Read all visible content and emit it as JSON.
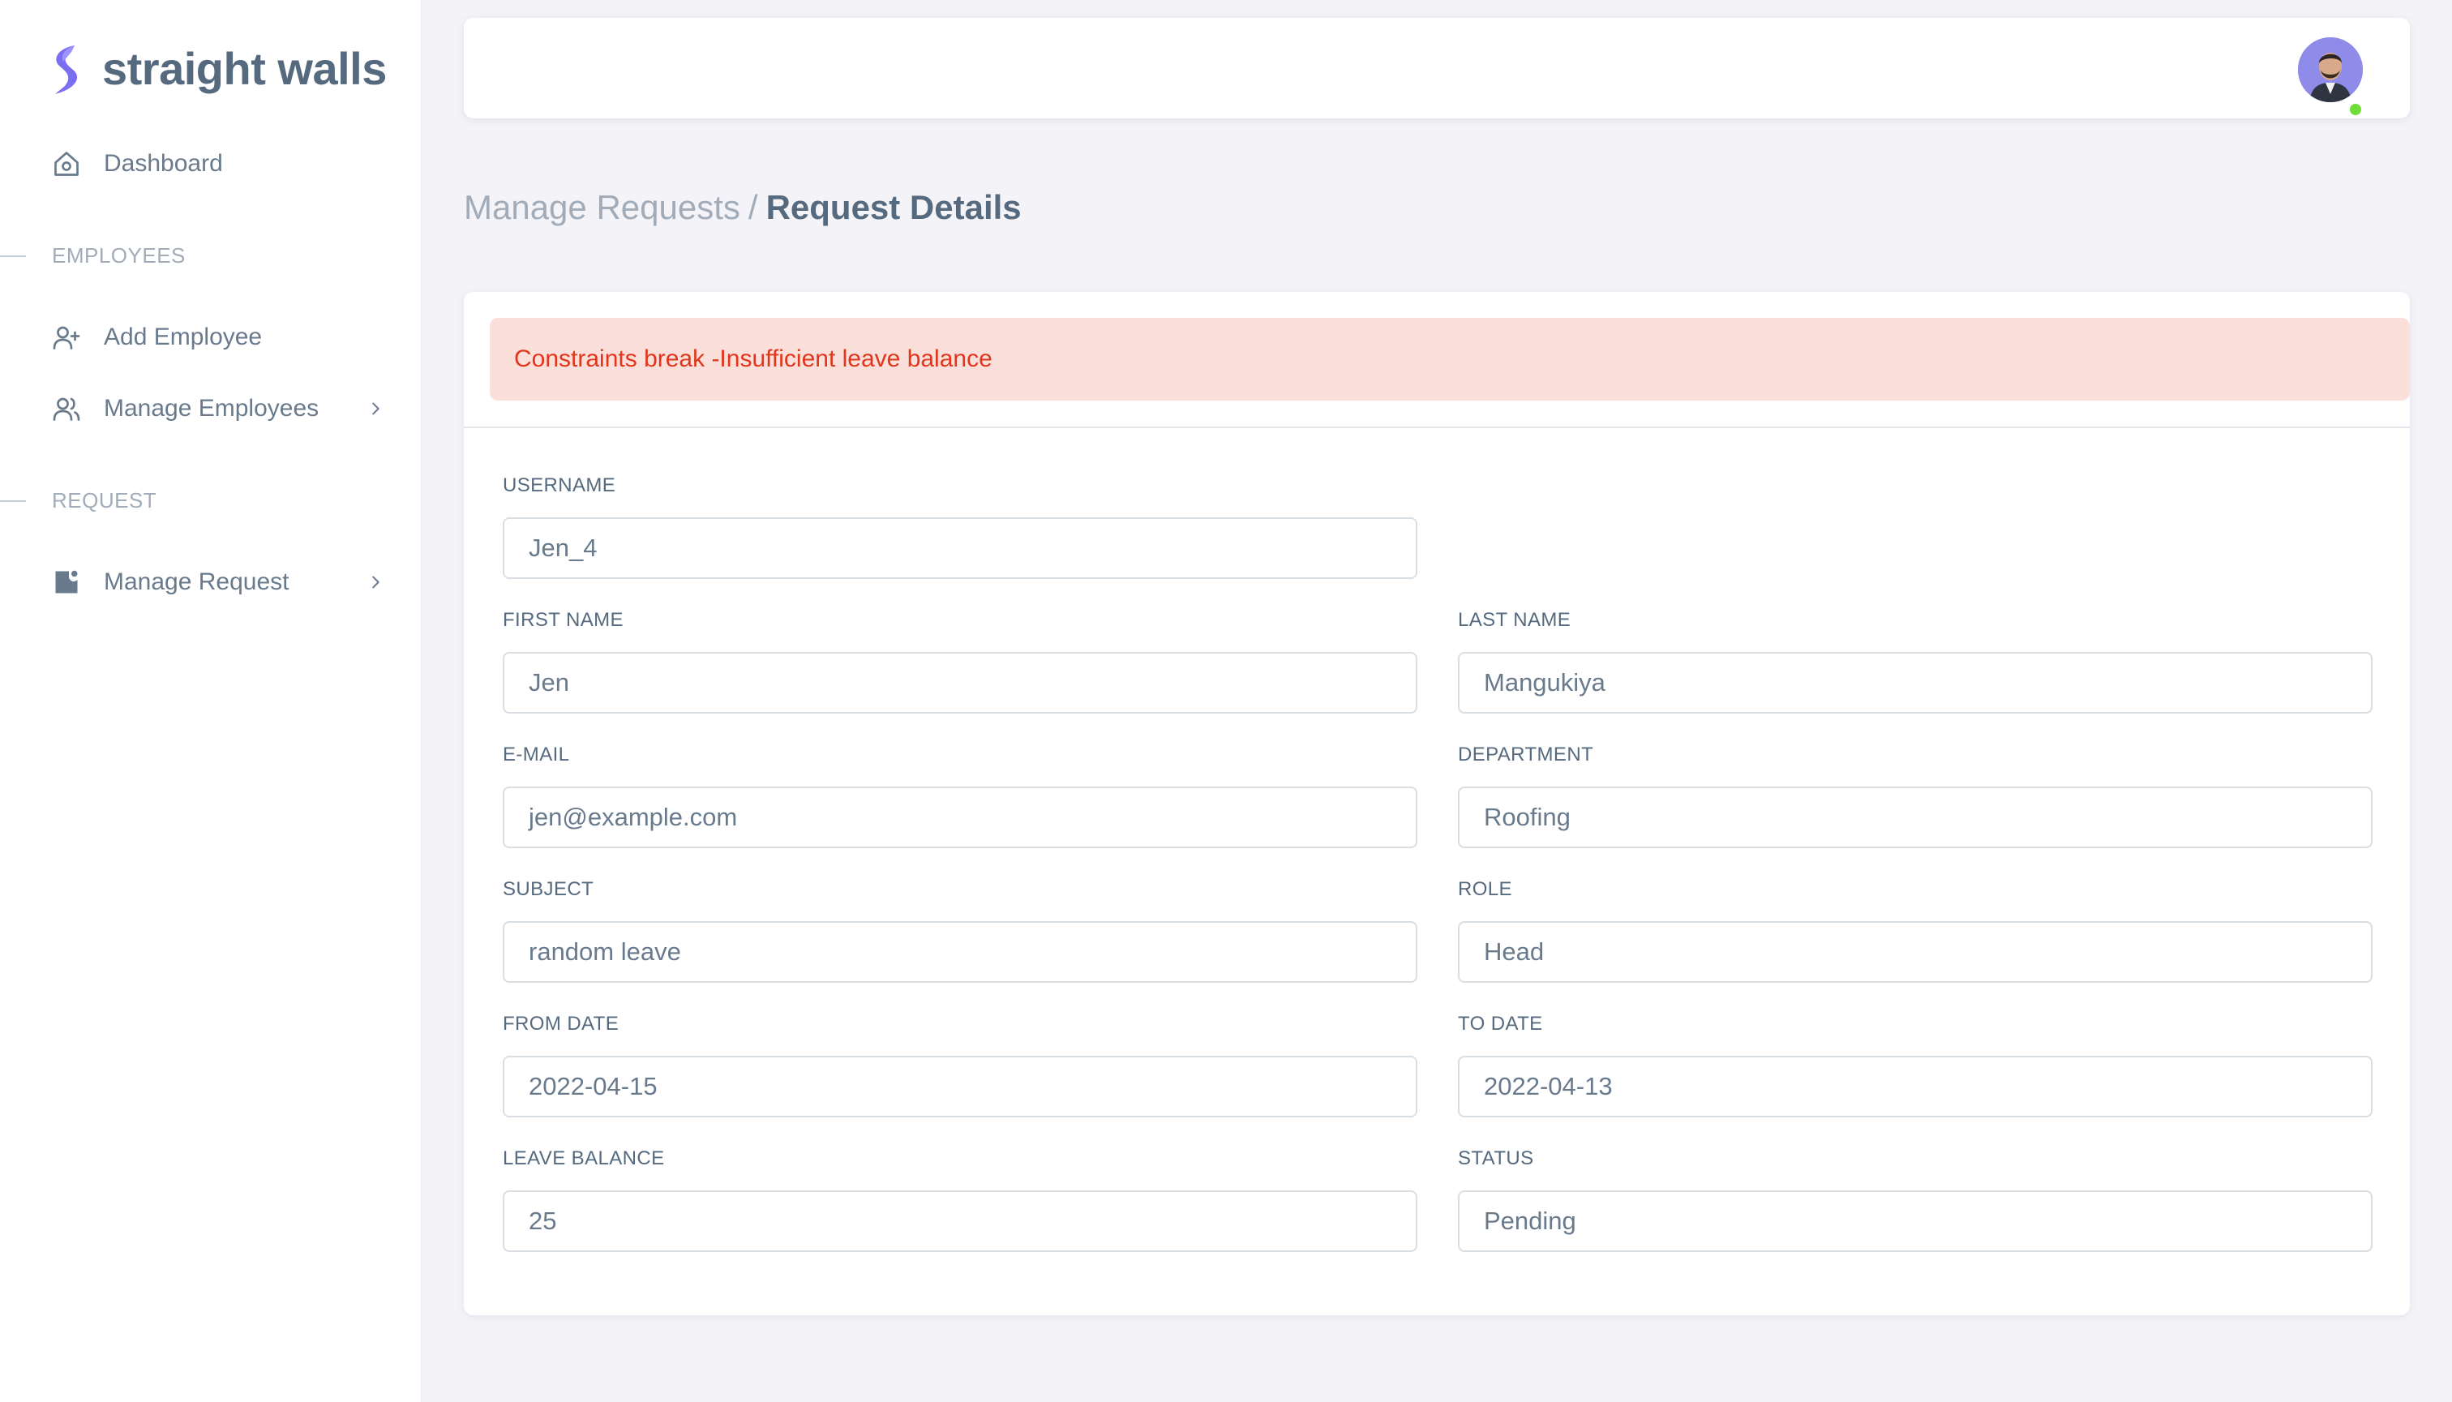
{
  "brand": {
    "name": "straight walls",
    "accent": "#7a6ff0"
  },
  "sidebar": {
    "dashboard": "Dashboard",
    "employees_header": "EMPLOYEES",
    "add_employee": "Add Employee",
    "manage_employees": "Manage Employees",
    "request_header": "REQUEST",
    "manage_request": "Manage Request"
  },
  "breadcrumb": {
    "parent": "Manage Requests",
    "separator": "/",
    "current": "Request Details"
  },
  "alert": {
    "message": "Constraints break -Insufficient leave balance",
    "color": "#e0361c"
  },
  "form": {
    "username": {
      "label": "USERNAME",
      "value": "Jen_4"
    },
    "first_name": {
      "label": "FIRST NAME",
      "value": "Jen"
    },
    "last_name": {
      "label": "LAST NAME",
      "value": "Mangukiya"
    },
    "email": {
      "label": "E-MAIL",
      "value": "jen@example.com"
    },
    "department": {
      "label": "DEPARTMENT",
      "value": "Roofing"
    },
    "subject": {
      "label": "SUBJECT",
      "value": "random leave"
    },
    "role": {
      "label": "ROLE",
      "value": "Head"
    },
    "from_date": {
      "label": "FROM DATE",
      "value": "2022-04-15"
    },
    "to_date": {
      "label": "TO DATE",
      "value": "2022-04-13"
    },
    "leave_balance": {
      "label": "LEAVE BALANCE",
      "value": "25"
    },
    "status": {
      "label": "STATUS",
      "value": "Pending"
    }
  },
  "user": {
    "online_status_color": "#71dd37"
  }
}
